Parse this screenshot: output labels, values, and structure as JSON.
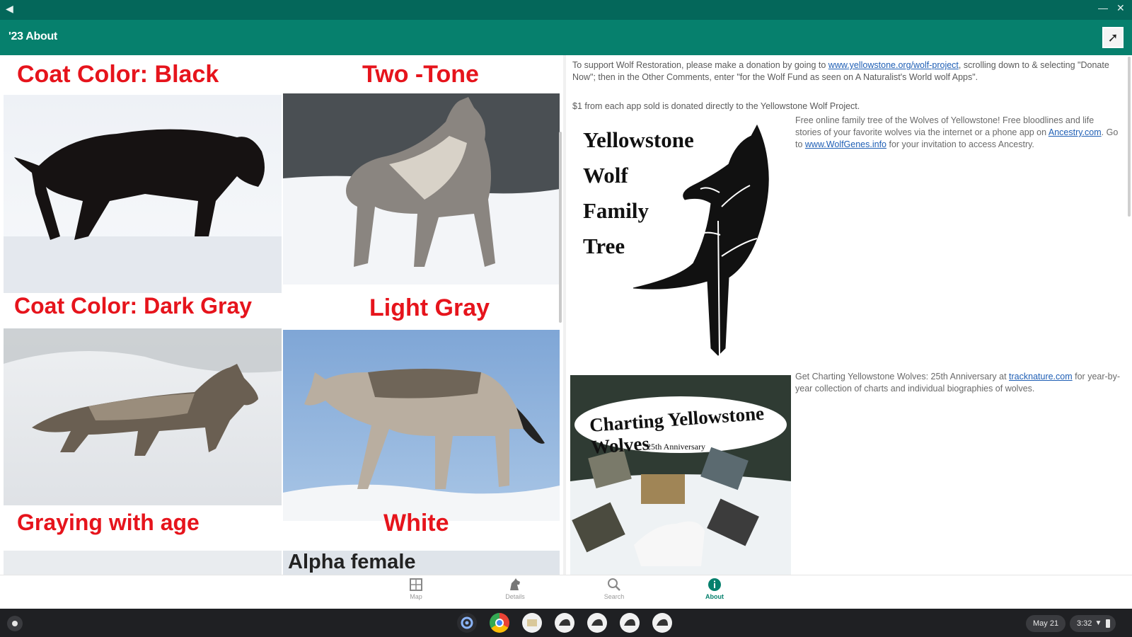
{
  "app": {
    "title": "'23 About"
  },
  "left_pane": {
    "labels": {
      "black": "Coat Color:  Black",
      "two_tone": "Two -Tone",
      "dark_gray": "Coat Color:  Dark Gray",
      "light_gray": "Light Gray",
      "graying": "Graying with age",
      "white": "White",
      "alpha_female": "Alpha female"
    }
  },
  "right_pane": {
    "donation": {
      "text_before": "To support Wolf Restoration, please make a donation by going to ",
      "link": "www.yellowstone.org/wolf-project",
      "text_after": ", scrolling down to & selecting \"Donate Now\"; then in the Other Comments, enter \"for the Wolf Fund as seen on A Naturalist's World wolf Apps\"."
    },
    "donated_line": "$1 from each app sold is donated directly to the Yellowstone Wolf Project.",
    "family_tree": {
      "title_lines": [
        "Yellowstone",
        "Wolf",
        "Family",
        "Tree"
      ],
      "text_before": "Free online family tree of the Wolves of Yellowstone! Free bloodlines and life stories of your favorite wolves via the internet or a phone app on ",
      "link1": "Ancestry.com",
      "text_middle": ". Go to ",
      "link2": "www.WolfGenes.info",
      "text_after": " for your invitation to access Ancestry."
    },
    "book": {
      "cover_title": "Charting Yellowstone Wolves",
      "cover_subtitle": "25th Anniversary",
      "text_before": "Get Charting Yellowstone Wolves: 25th Anniversary at ",
      "link": "tracknature.com",
      "text_after": " for year-by-year collection of charts and individual biographies of wolves."
    }
  },
  "bottom_nav": {
    "items": [
      {
        "label": "Map",
        "icon": "map-icon"
      },
      {
        "label": "Details",
        "icon": "wolf-icon"
      },
      {
        "label": "Search",
        "icon": "search-icon"
      },
      {
        "label": "About",
        "icon": "info-icon"
      }
    ]
  },
  "shelf": {
    "date": "May 21",
    "time": "3:32"
  }
}
